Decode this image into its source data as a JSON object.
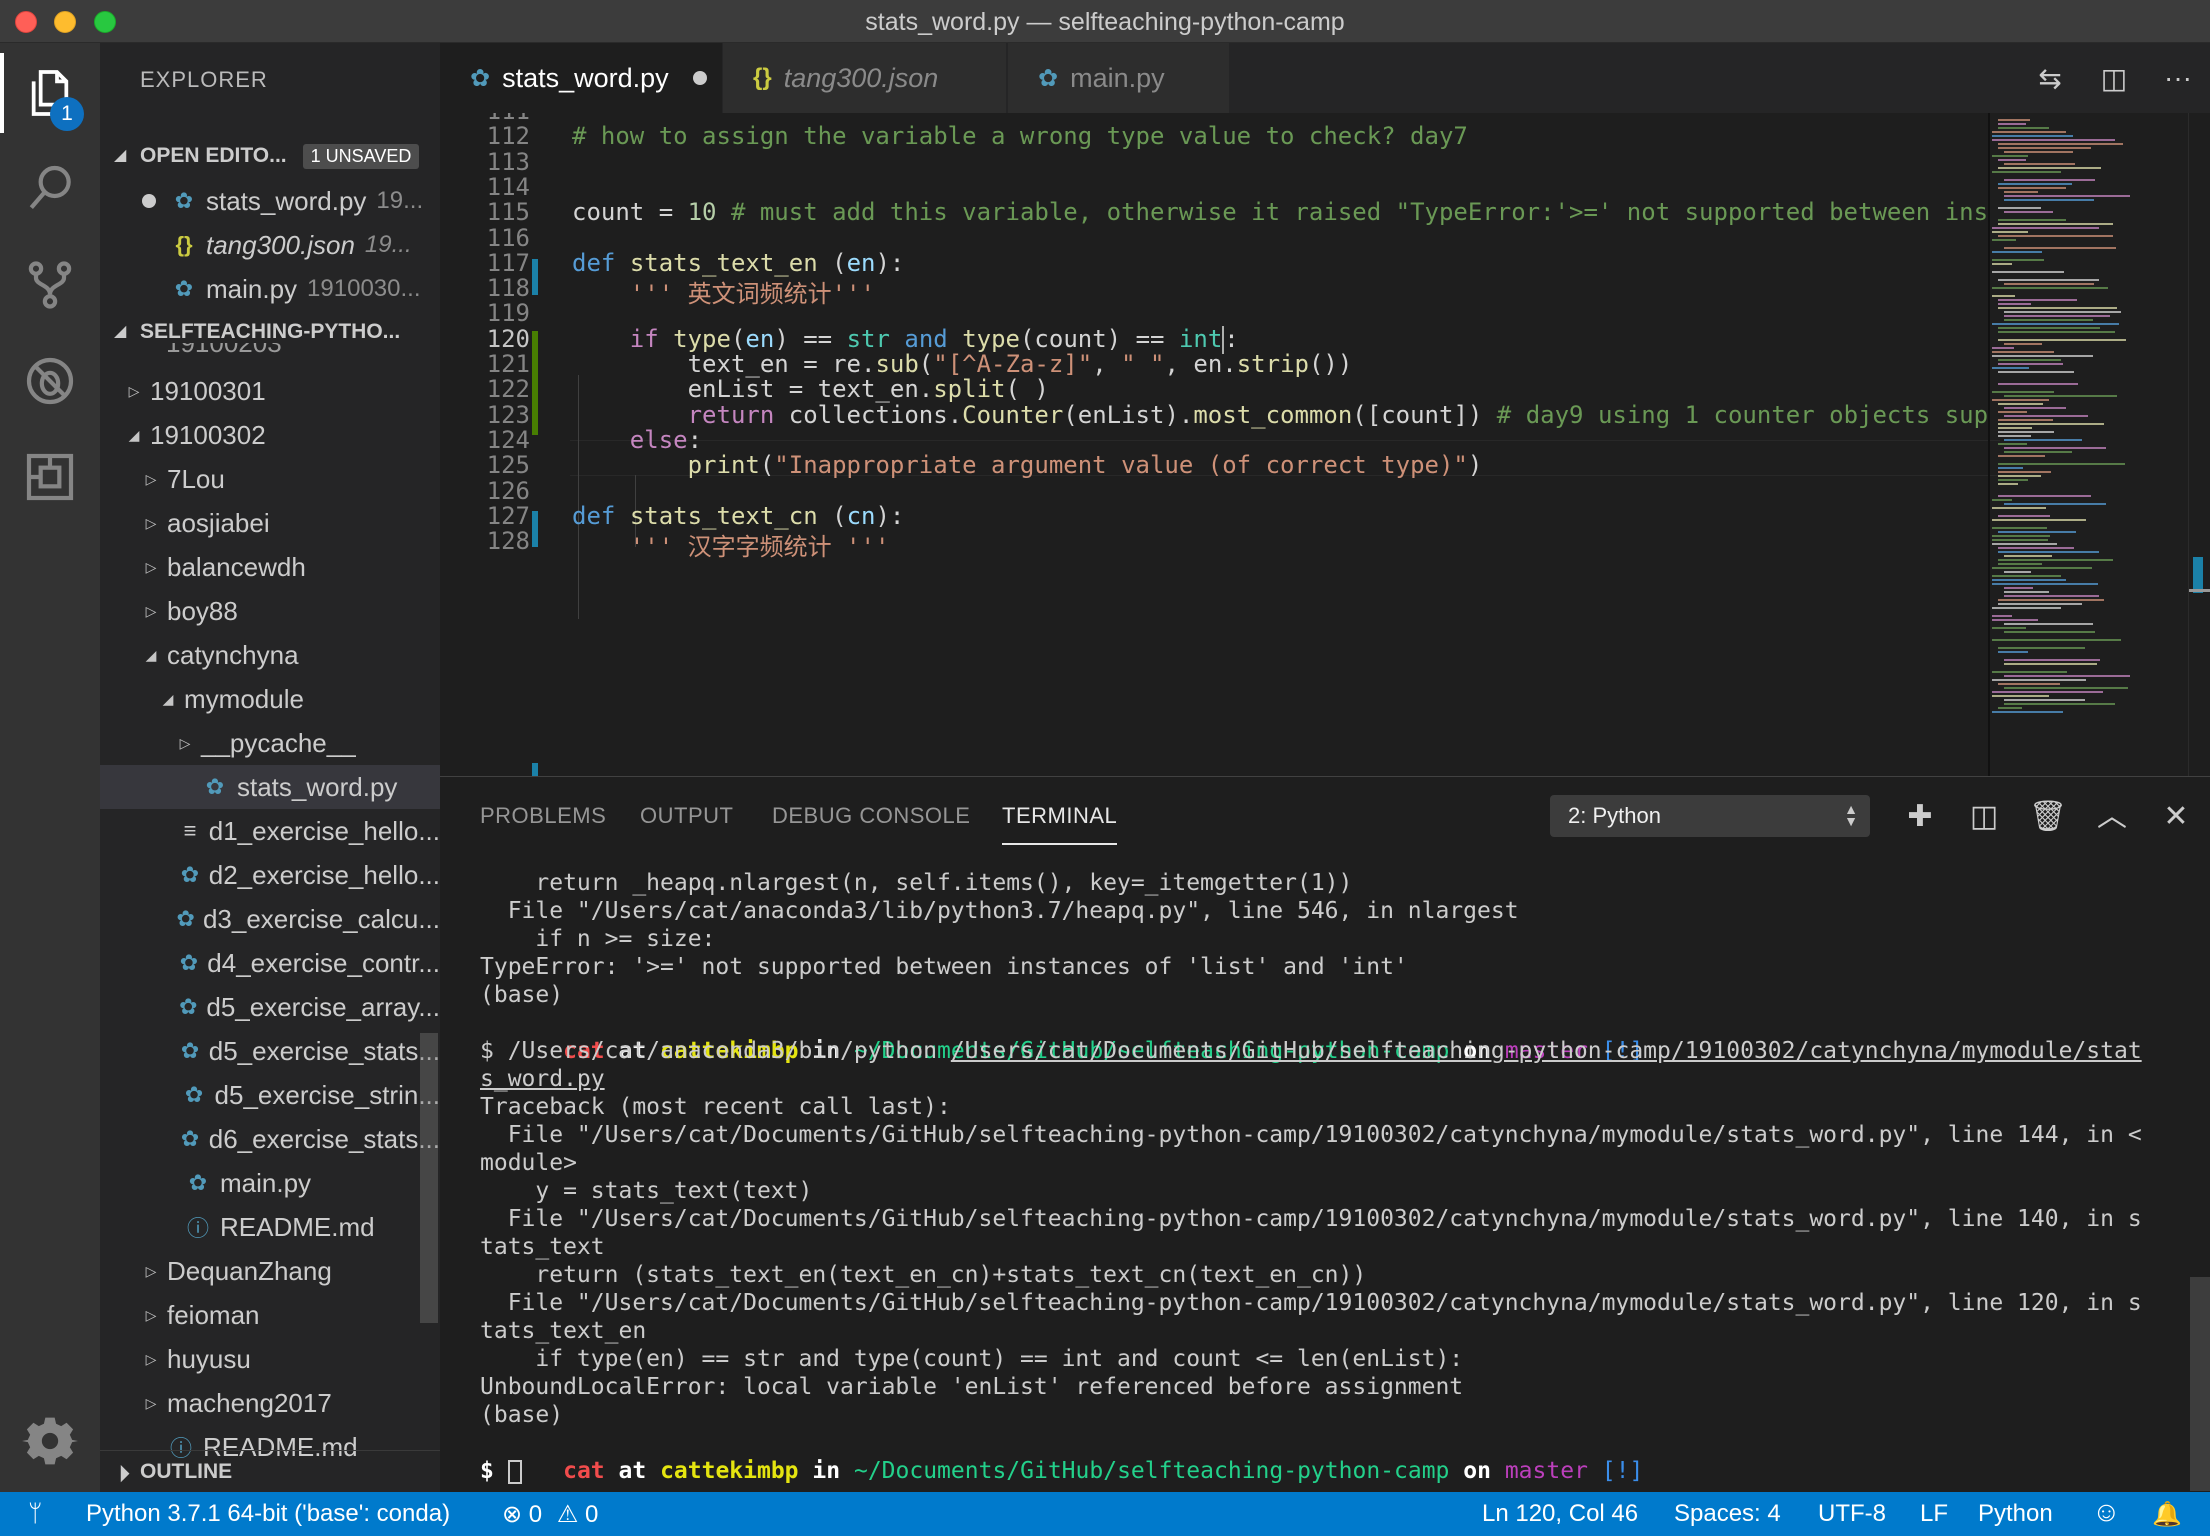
{
  "window": {
    "title": "stats_word.py — selfteaching-python-camp"
  },
  "activity": {
    "explorer_badge": "1"
  },
  "sidebar": {
    "title": "EXPLORER",
    "open_editors": {
      "header": "OPEN EDITO...",
      "badge": "1 UNSAVED",
      "items": [
        {
          "name": "stats_word.py",
          "path": "19..."
        },
        {
          "name": "tang300.json",
          "path": "19..."
        },
        {
          "name": "main.py",
          "path": "1910030..."
        }
      ]
    },
    "project": {
      "header": "SELFTEACHING-PYTHO...",
      "partial": "19100203",
      "items": [
        {
          "label": "19100301",
          "type": "folder-closed",
          "indent": 0
        },
        {
          "label": "19100302",
          "type": "folder-open",
          "indent": 0
        },
        {
          "label": "7Lou",
          "type": "folder-closed",
          "indent": 1
        },
        {
          "label": "aosjiabei",
          "type": "folder-closed",
          "indent": 1
        },
        {
          "label": "balancewdh",
          "type": "folder-closed",
          "indent": 1
        },
        {
          "label": "boy88",
          "type": "folder-closed",
          "indent": 1
        },
        {
          "label": "catynchyna",
          "type": "folder-open",
          "indent": 1
        },
        {
          "label": "mymodule",
          "type": "folder-open",
          "indent": 2
        },
        {
          "label": "__pycache__",
          "type": "folder-closed",
          "indent": 3
        },
        {
          "label": "stats_word.py",
          "type": "py",
          "indent": 3
        },
        {
          "label": "d1_exercise_hello...",
          "type": "txt",
          "indent": 2
        },
        {
          "label": "d2_exercise_hello...",
          "type": "py",
          "indent": 2
        },
        {
          "label": "d3_exercise_calcu...",
          "type": "py",
          "indent": 2
        },
        {
          "label": "d4_exercise_contr...",
          "type": "py",
          "indent": 2
        },
        {
          "label": "d5_exercise_array...",
          "type": "py",
          "indent": 2
        },
        {
          "label": "d5_exercise_stats...",
          "type": "py",
          "indent": 2
        },
        {
          "label": "d5_exercise_strin...",
          "type": "py",
          "indent": 2
        },
        {
          "label": "d6_exercise_stats...",
          "type": "py",
          "indent": 2
        },
        {
          "label": "main.py",
          "type": "py",
          "indent": 2
        },
        {
          "label": "README.md",
          "type": "info",
          "indent": 2
        },
        {
          "label": "DequanZhang",
          "type": "folder-closed",
          "indent": 1
        },
        {
          "label": "feioman",
          "type": "folder-closed",
          "indent": 1
        },
        {
          "label": "huyusu",
          "type": "folder-closed",
          "indent": 1
        },
        {
          "label": "macheng2017",
          "type": "folder-closed",
          "indent": 1
        },
        {
          "label": "README.md",
          "type": "info",
          "indent": 1
        }
      ]
    },
    "outline": "OUTLINE"
  },
  "tabs": [
    {
      "label": "stats_word.py",
      "icon": "python-icon",
      "active": true,
      "modified": true
    },
    {
      "label": "tang300.json",
      "icon": "json-icon",
      "active": false,
      "modified": false
    },
    {
      "label": "main.py",
      "icon": "python-icon",
      "active": false,
      "modified": false
    }
  ],
  "editor": {
    "cursor_line": "120",
    "lines": [
      {
        "num": "111",
        "code": ""
      },
      {
        "num": "112",
        "code": "# how to assign the variable a wrong type value to check? day7"
      },
      {
        "num": "113",
        "code": ""
      },
      {
        "num": "114",
        "code": ""
      },
      {
        "num": "115",
        "code": "count = 10 # must add this variable, otherwise it raised \"TypeError:'>=' not supported between ins"
      },
      {
        "num": "116",
        "code": ""
      },
      {
        "num": "117",
        "code": "def stats_text_en (en):"
      },
      {
        "num": "118",
        "code": "    ''' 英文词频统计'''"
      },
      {
        "num": "119",
        "code": ""
      },
      {
        "num": "120",
        "code": "    if type(en) == str and type(count) == int:"
      },
      {
        "num": "121",
        "code": "        text_en = re.sub(\"[^A-Za-z]\", \" \", en.strip())"
      },
      {
        "num": "122",
        "code": "        enList = text_en.split( )"
      },
      {
        "num": "123",
        "code": "        return collections.Counter(enList).most_common([count]) # day9 using 1 counter objects sup"
      },
      {
        "num": "124",
        "code": "    else:"
      },
      {
        "num": "125",
        "code": "        print(\"Inappropriate argument value (of correct type)\")"
      },
      {
        "num": "126",
        "code": ""
      },
      {
        "num": "127",
        "code": "def stats_text_cn (cn):"
      },
      {
        "num": "128",
        "code": "    ''' 汉字字频统计 '''"
      }
    ]
  },
  "panel": {
    "tabs": [
      "PROBLEMS",
      "OUTPUT",
      "DEBUG CONSOLE",
      "TERMINAL"
    ],
    "active_tab": "TERMINAL",
    "terminal_select": "2: Python",
    "prompt": {
      "user": "cat",
      "at": "at",
      "host": "cattekimbp",
      "in": "in",
      "path": "~/Documents/GitHub/selfteaching-python-camp",
      "on": "on",
      "branch": "master",
      "flag": "[!]"
    },
    "terminal_lines": [
      "    return _heapq.nlargest(n, self.items(), key=_itemgetter(1))",
      "  File \"/Users/cat/anaconda3/lib/python3.7/heapq.py\", line 546, in nlargest",
      "    if n >= size:",
      "TypeError: '>=' not supported between instances of 'list' and 'int'",
      "(base)"
    ],
    "command": {
      "prefix": "$ /Users/cat/anaconda3/bin/python ",
      "path_line1": "/Users/cat/Documents/GitHub/selfteaching-python-camp/19100302/catynchyna/mymodule/stat",
      "path_line2": "s_word.py"
    },
    "traceback_lines": [
      "Traceback (most recent call last):",
      "  File \"/Users/cat/Documents/GitHub/selfteaching-python-camp/19100302/catynchyna/mymodule/stats_word.py\", line 144, in <",
      "module>",
      "    y = stats_text(text)",
      "  File \"/Users/cat/Documents/GitHub/selfteaching-python-camp/19100302/catynchyna/mymodule/stats_word.py\", line 140, in s",
      "tats_text",
      "    return (stats_text_en(text_en_cn)+stats_text_cn(text_en_cn))",
      "  File \"/Users/cat/Documents/GitHub/selfteaching-python-camp/19100302/catynchyna/mymodule/stats_word.py\", line 120, in s",
      "tats_text_en",
      "    if type(en) == str and type(count) == int and count <= len(enList):",
      "UnboundLocalError: local variable 'enList' referenced before assignment",
      "(base)"
    ],
    "final_prompt": "$"
  },
  "statusbar": {
    "interpreter": "Python 3.7.1 64-bit ('base': conda)",
    "errors": "0",
    "warnings": "0",
    "position": "Ln 120, Col 46",
    "spaces": "Spaces: 4",
    "encoding": "UTF-8",
    "eol": "LF",
    "language": "Python"
  },
  "colors": {
    "accent": "#007acc",
    "activity_bg": "#333333",
    "sidebar_bg": "#252526",
    "editor_bg": "#1e1e1e"
  }
}
